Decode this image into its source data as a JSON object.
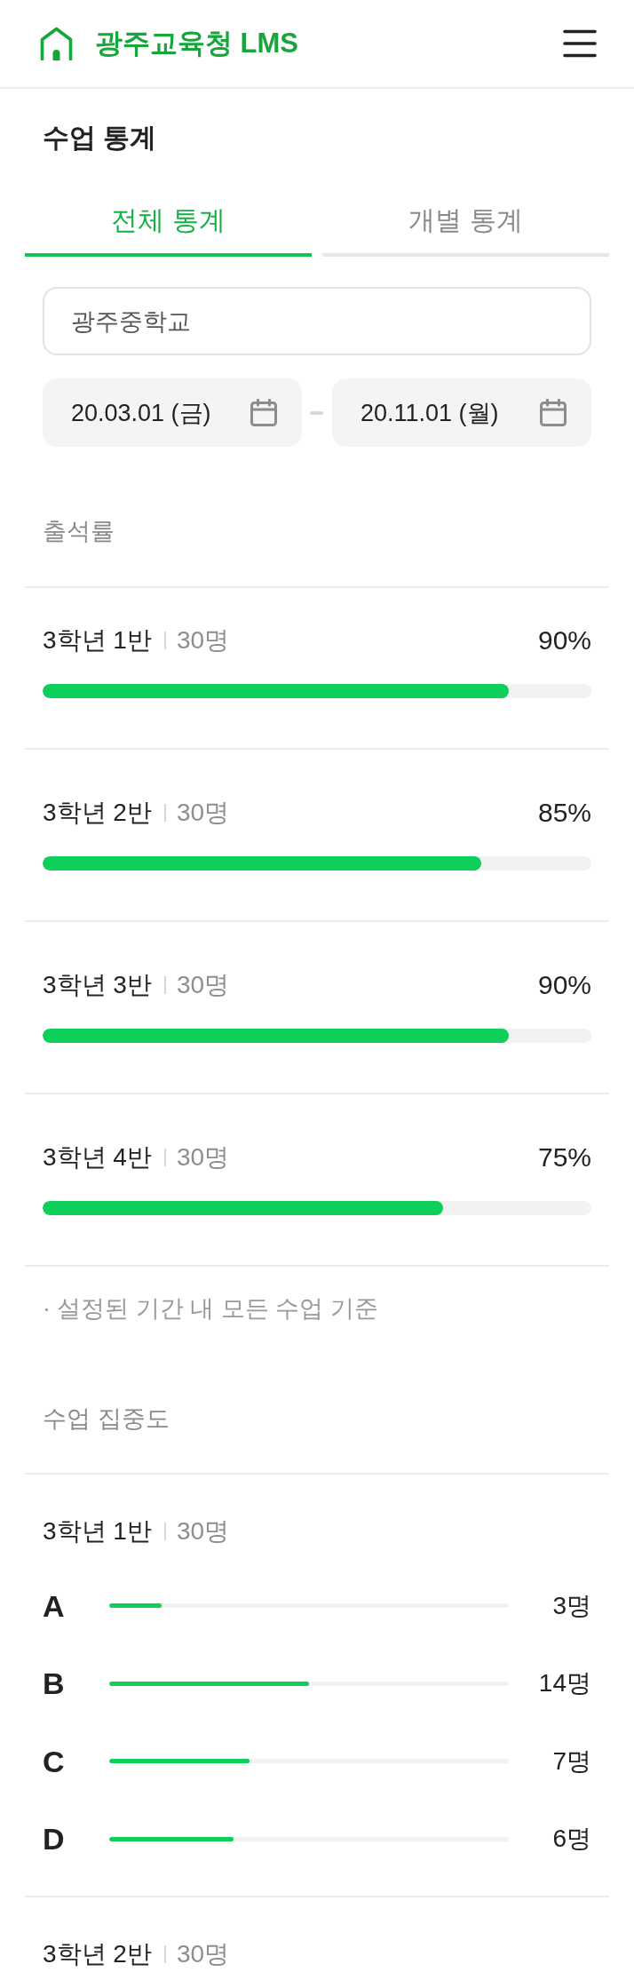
{
  "header": {
    "title": "광주교육청 LMS"
  },
  "page_title": "수업 통계",
  "tabs": [
    {
      "label": "전체 통계",
      "selected": true
    },
    {
      "label": "개별 통계",
      "selected": false
    }
  ],
  "filters": {
    "school": {
      "value": "광주중학교"
    },
    "date_from": {
      "value": "20.03.01 (금)"
    },
    "date_to": {
      "value": "20.11.01 (월)"
    }
  },
  "attendance": {
    "title": "출석률",
    "rows": [
      {
        "class": "3학년 1반",
        "count": "30명",
        "rate": "90%",
        "level": 0.85
      },
      {
        "class": "3학년 2반",
        "count": "30명",
        "rate": "85%",
        "level": 0.8
      },
      {
        "class": "3학년 3반",
        "count": "30명",
        "rate": "90%",
        "level": 0.85
      },
      {
        "class": "3학년 4반",
        "count": "30명",
        "rate": "75%",
        "level": 0.73
      }
    ],
    "note": "· 설정된 기간 내 모든 수업 기준"
  },
  "concentration": {
    "title": "수업 집중도",
    "classes": [
      {
        "class": "3학년 1반",
        "count": "30명",
        "grades": [
          {
            "grade": "A",
            "count": "3명",
            "level": 0.13
          },
          {
            "grade": "B",
            "count": "14명",
            "level": 0.5
          },
          {
            "grade": "C",
            "count": "7명",
            "level": 0.35
          },
          {
            "grade": "D",
            "count": "6명",
            "level": 0.31
          }
        ]
      },
      {
        "class": "3학년 2반",
        "count": "30명"
      }
    ]
  }
}
